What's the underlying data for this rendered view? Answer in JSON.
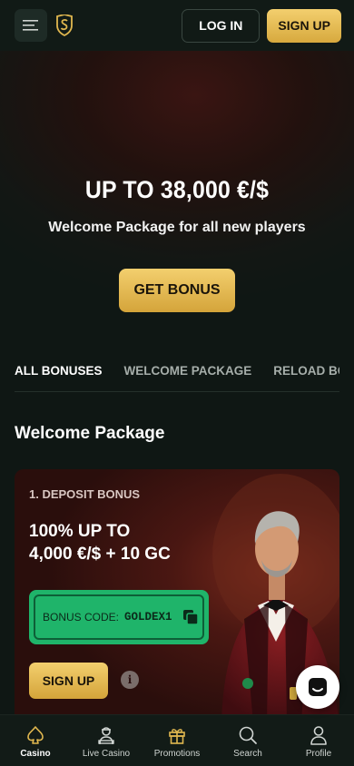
{
  "header": {
    "login_label": "LOG IN",
    "signup_label": "SIGN UP"
  },
  "hero": {
    "title": "UP TO 38,000 €/$",
    "subtitle": "Welcome Package for all new players",
    "cta_label": "GET BONUS"
  },
  "tabs": [
    {
      "label": "ALL BONUSES",
      "active": true
    },
    {
      "label": "WELCOME PACKAGE",
      "active": false
    },
    {
      "label": "RELOAD BONUSES",
      "active": false
    }
  ],
  "section": {
    "title": "Welcome Package"
  },
  "card": {
    "label": "1. DEPOSIT BONUS",
    "title_line1": "100% UP TO",
    "title_line2": "4,000 €/$ + 10 GC",
    "code_label": "BONUS CODE:",
    "code_value": "GOLDEX1",
    "signup_label": "SIGN UP",
    "info_glyph": "i"
  },
  "bottom_nav": [
    {
      "label": "Casino",
      "icon": "spade-icon",
      "active": true
    },
    {
      "label": "Live Casino",
      "icon": "dealer-icon",
      "active": false
    },
    {
      "label": "Promotions",
      "icon": "gift-icon",
      "active": false
    },
    {
      "label": "Search",
      "icon": "search-icon",
      "active": false
    },
    {
      "label": "Profile",
      "icon": "profile-icon",
      "active": false
    }
  ],
  "colors": {
    "accent_gold": "#e0b74f",
    "code_green": "#1fb46a",
    "background": "#0f1714"
  }
}
